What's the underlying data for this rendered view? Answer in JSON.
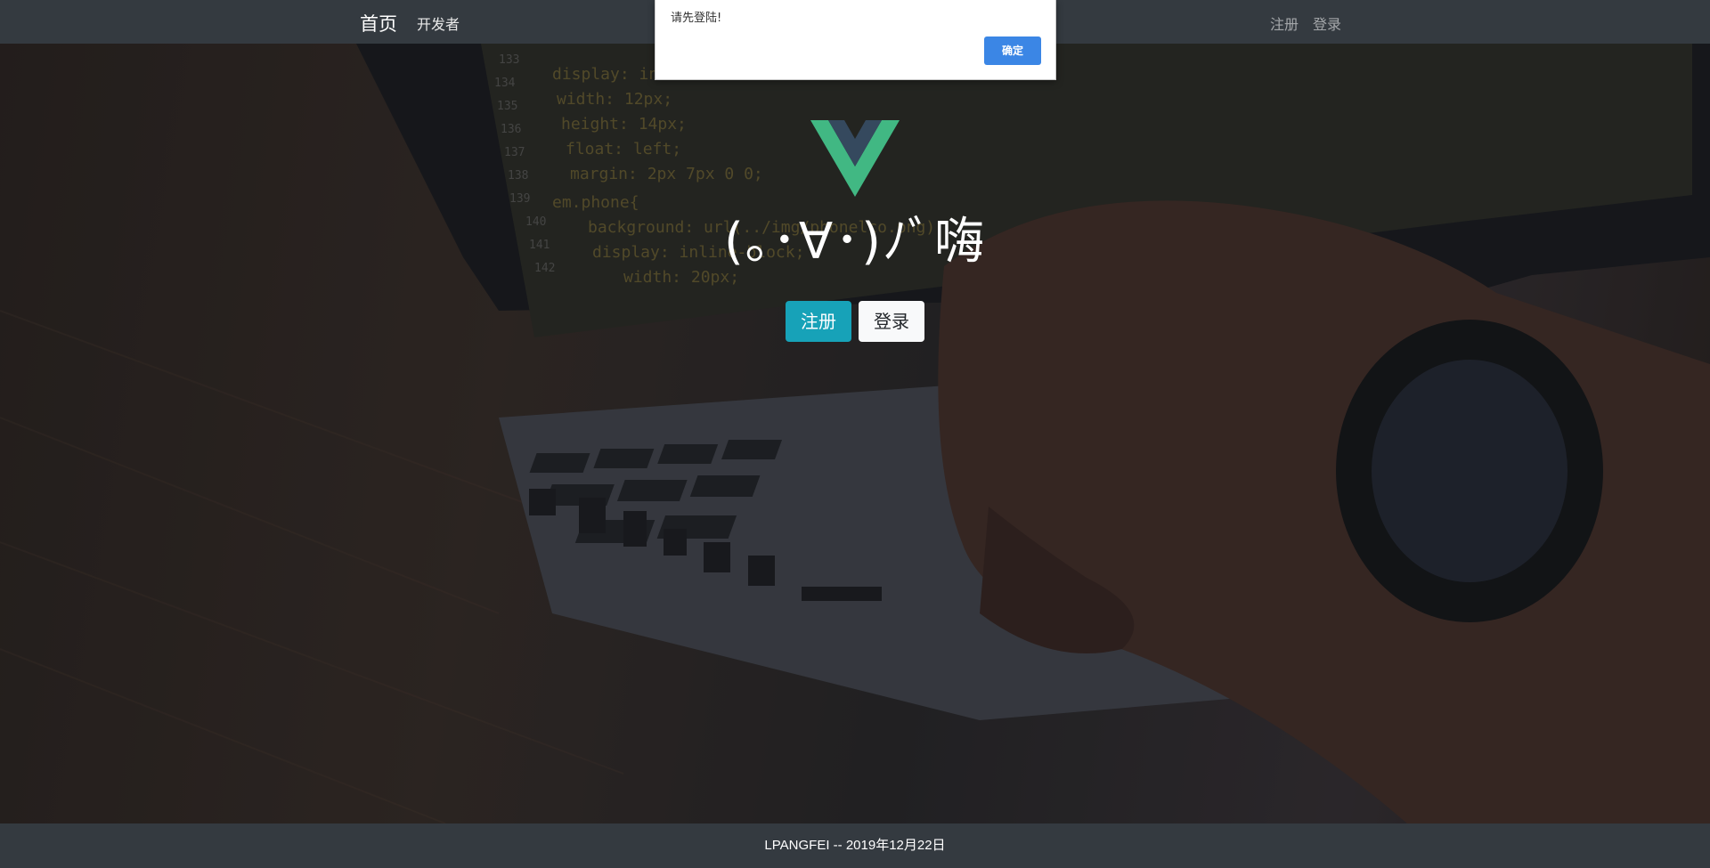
{
  "navbar": {
    "brand": "首页",
    "developer_link": "开发者",
    "register_link": "注册",
    "login_link": "登录"
  },
  "hero": {
    "greeting": "(｡･∀･)ﾉﾞ嗨",
    "register_button": "注册",
    "login_button": "登录"
  },
  "footer": {
    "text": "LPANGFEI -- 2019年12月22日"
  },
  "alert": {
    "message": "请先登陆!",
    "ok_button": "确定"
  },
  "colors": {
    "navbar": "#343a40",
    "register_button": "#17a2b8",
    "login_button": "#f8f9fa",
    "alert_button": "#3b86e5",
    "vue_green": "#41b883",
    "vue_dark": "#35495e"
  },
  "icons": {
    "logo": "vue-logo-icon"
  }
}
